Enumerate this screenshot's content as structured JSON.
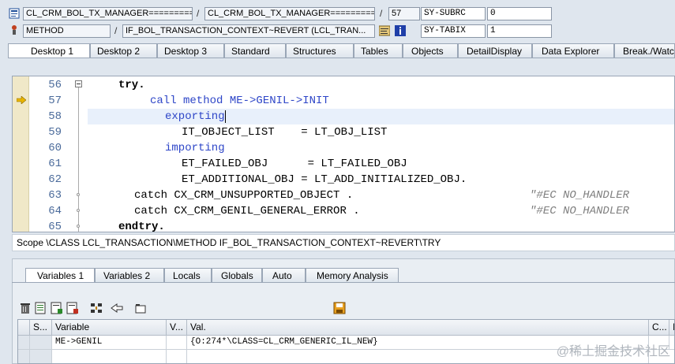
{
  "header": {
    "row1": {
      "program": "CL_CRM_BOL_TX_MANAGER=========...",
      "include": "CL_CRM_BOL_TX_MANAGER=========...",
      "line": "57",
      "sysfield_label": "SY-SUBRC",
      "sysfield_value": "0"
    },
    "row2": {
      "event_type": "METHOD",
      "event": "IF_BOL_TRANSACTION_CONTEXT~REVERT (LCL_TRAN...",
      "sysfield_label": "SY-TABIX",
      "sysfield_value": "1"
    }
  },
  "desktop_tabs": [
    "Desktop 1",
    "Desktop 2",
    "Desktop 3",
    "Standard",
    "Structures",
    "Tables",
    "Objects",
    "DetailDisplay",
    "Data Explorer",
    "Break./Watc"
  ],
  "code": {
    "current_line": "57",
    "lines": [
      {
        "no": "56",
        "text": "try."
      },
      {
        "no": "57",
        "text": "call method ME->GENIL->INIT"
      },
      {
        "no": "58",
        "text": "exporting"
      },
      {
        "no": "59",
        "text": "IT_OBJECT_LIST    = LT_OBJ_LIST"
      },
      {
        "no": "60",
        "text": "importing"
      },
      {
        "no": "61",
        "text": "ET_FAILED_OBJ      = LT_FAILED_OBJ"
      },
      {
        "no": "62",
        "text": "ET_ADDITIONAL_OBJ = LT_ADD_INITIALIZED_OBJ."
      },
      {
        "no": "63",
        "text": "catch CX_CRM_UNSUPPORTED_OBJECT .",
        "comment": "\"#EC NO_HANDLER"
      },
      {
        "no": "64",
        "text": "catch CX_CRM_GENIL_GENERAL_ERROR .",
        "comment": "\"#EC NO_HANDLER"
      },
      {
        "no": "65",
        "text": "endtry."
      }
    ]
  },
  "scope": "Scope \\CLASS LCL_TRANSACTION\\METHOD IF_BOL_TRANSACTION_CONTEXT~REVERT\\TRY",
  "variable_tabs": [
    "Variables 1",
    "Variables 2",
    "Locals",
    "Globals",
    "Auto",
    "Memory Analysis"
  ],
  "grid": {
    "columns": [
      "S...",
      "Variable",
      "V...",
      "Val.",
      "C...",
      "I"
    ],
    "rows": [
      {
        "variable": "ME->GENIL",
        "value": "{O:274*\\CLASS=CL_CRM_GENERIC_IL_NEW}"
      }
    ]
  },
  "watermark": "@稀土掘金技术社区",
  "icons": {
    "row1": "program-icon",
    "row2": "event-icon",
    "source": "source-icon",
    "info": "info-icon",
    "current_line_marker": "execution-arrow-icon"
  },
  "colors": {
    "keyword": "#2e46c8",
    "comment": "#808080",
    "gutter": "#f0e8c8",
    "arrow": "#e8b400"
  }
}
